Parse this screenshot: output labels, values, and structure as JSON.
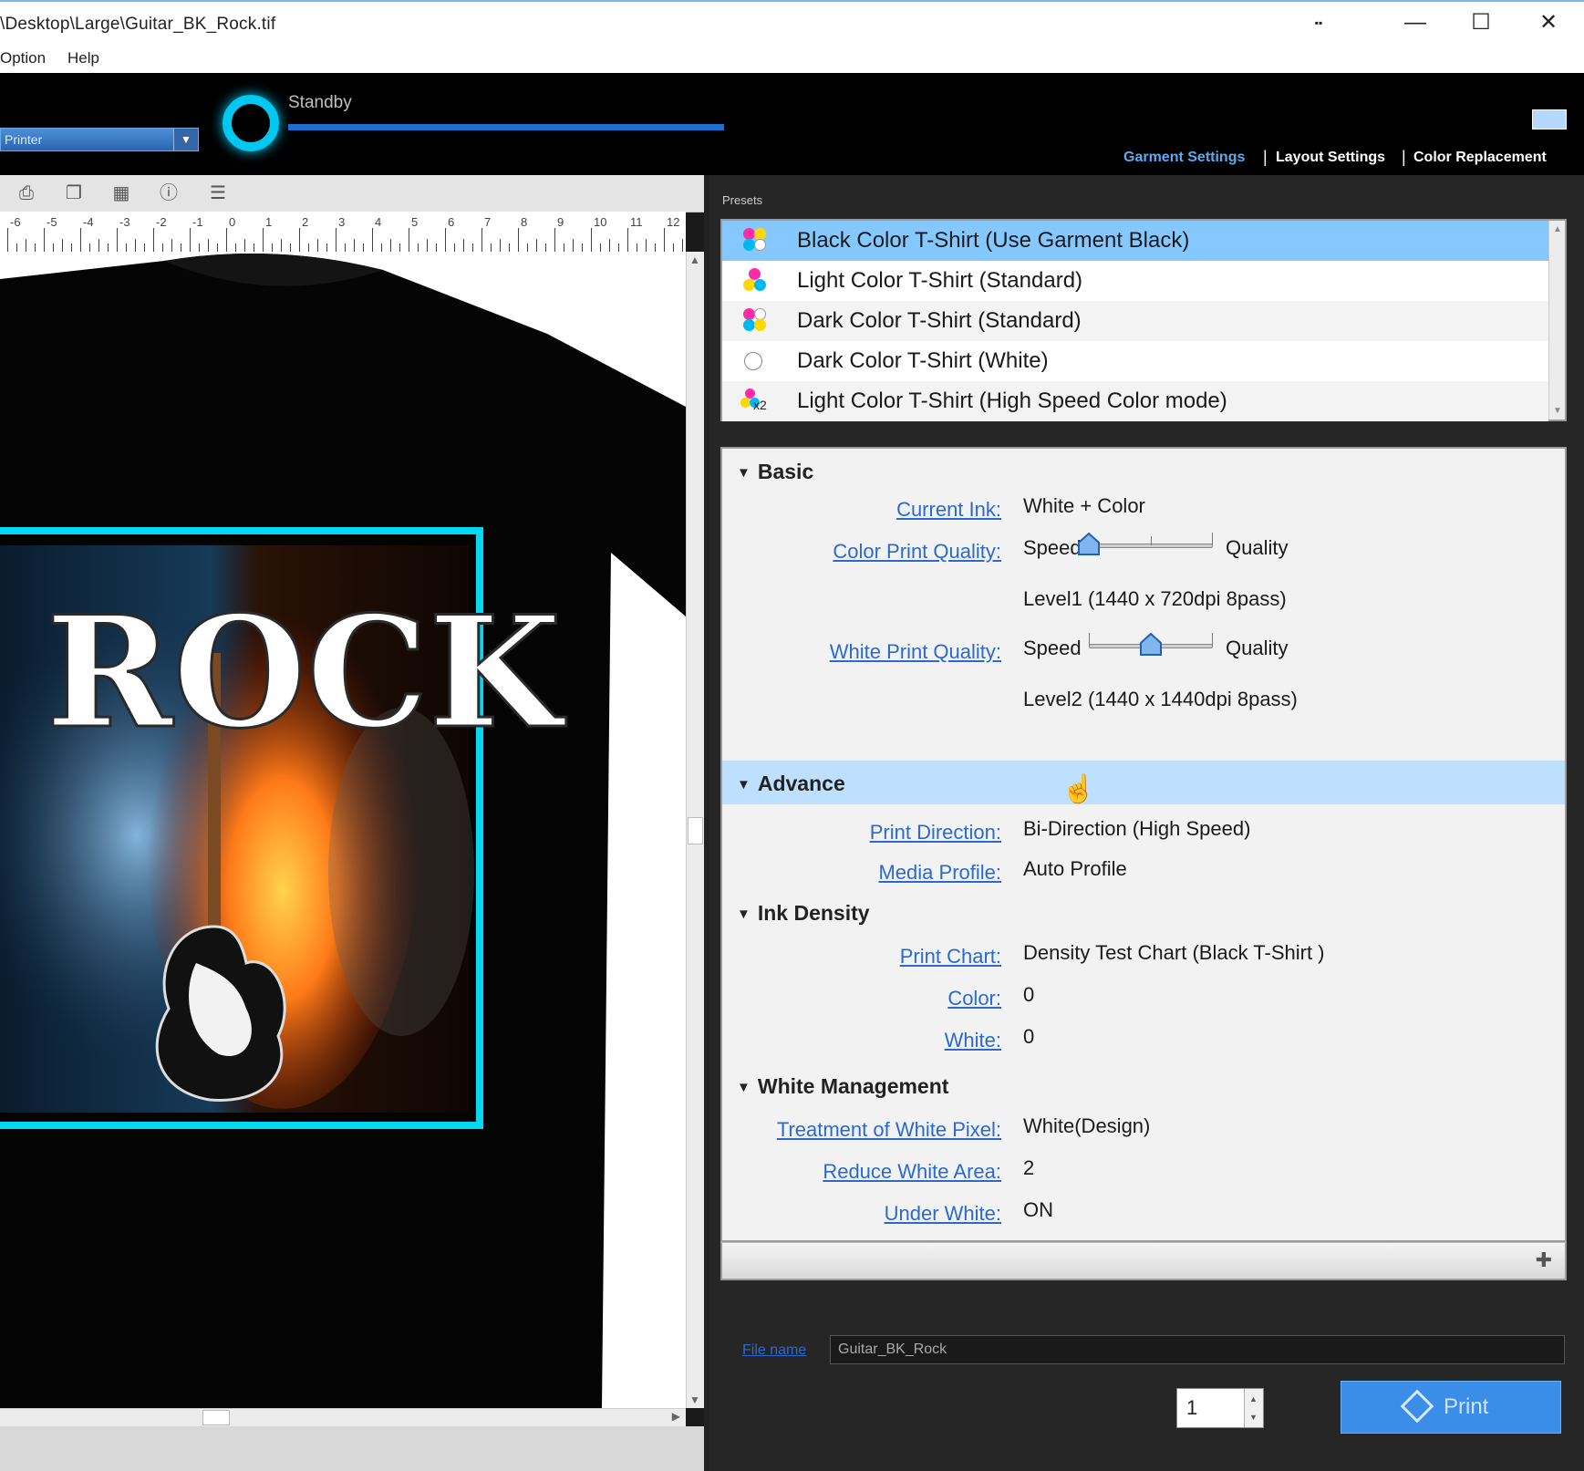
{
  "window": {
    "title": "\\Desktop\\Large\\Guitar_BK_Rock.tif",
    "controls": {
      "restore_glyph": "▪▪",
      "minimize_glyph": "—",
      "maximize_glyph": "☐",
      "close_glyph": "✕"
    }
  },
  "menubar": {
    "items": [
      "Option",
      "Help"
    ]
  },
  "header": {
    "printer_select": "Printer",
    "status_text": "Standby",
    "status_progress": 1.0,
    "nav": [
      "Garment Settings",
      "Layout Settings",
      "Color Replacement"
    ],
    "nav_active": "Garment Settings",
    "nav_separator": "|"
  },
  "canvas": {
    "ruler_labels": [
      "-6",
      "-5",
      "-4",
      "-3",
      "-2",
      "-1",
      "0",
      "1",
      "2",
      "3",
      "4",
      "5",
      "6",
      "7",
      "8",
      "9",
      "10",
      "11",
      "12"
    ],
    "design_text": "ROCK"
  },
  "presets": {
    "label": "Presets",
    "items": [
      {
        "name": "Black Color T-Shirt (Use Garment Black)",
        "icon": "cmyk-dots-icon",
        "selected": true
      },
      {
        "name": "Light Color T-Shirt (Standard)",
        "icon": "cmy-dots-icon",
        "selected": false
      },
      {
        "name": "Dark Color T-Shirt (Standard)",
        "icon": "cmyk-white-dots-icon",
        "selected": false
      },
      {
        "name": "Dark Color T-Shirt (White)",
        "icon": "white-circle-icon",
        "selected": false
      },
      {
        "name": "Light Color T-Shirt (High Speed Color mode)",
        "icon": "cmy-x2-dots-icon",
        "badge": "x2",
        "selected": false
      }
    ]
  },
  "settings": {
    "basic": {
      "title": "Basic",
      "current_ink_label": "Current Ink:",
      "current_ink": "White + Color",
      "color_quality_label": "Color Print Quality:",
      "speed_label": "Speed",
      "quality_label": "Quality",
      "color_quality_level": 0.0,
      "color_quality_text": "Level1 (1440 x 720dpi 8pass)",
      "white_quality_label": "White Print Quality:",
      "white_quality_level": 0.5,
      "white_quality_text": "Level2 (1440 x 1440dpi 8pass)"
    },
    "advance": {
      "title": "Advance",
      "print_direction_label": "Print Direction:",
      "print_direction": "Bi-Direction (High Speed)",
      "media_profile_label": "Media Profile:",
      "media_profile": "Auto Profile"
    },
    "ink_density": {
      "title": "Ink Density",
      "print_chart_label": "Print Chart:",
      "print_chart": "Density Test Chart (Black T-Shirt )",
      "color_label": "Color:",
      "color": "0",
      "white_label": "White:",
      "white": "0"
    },
    "white_management": {
      "title": "White Management",
      "treatment_label": "Treatment of White Pixel:",
      "treatment": "White(Design)",
      "reduce_label": "Reduce White Area:",
      "reduce": "2",
      "under_white_label": "Under White:",
      "under_white": "ON"
    }
  },
  "footer": {
    "filename_label": "File name",
    "filename": "Guitar_BK_Rock",
    "copies": "1",
    "print_button": "Print"
  },
  "colors": {
    "accent": "#3b8ee8",
    "status_ring": "#00c8f0",
    "selection": "#84c8ff",
    "link": "#2a6ad0",
    "frame": "#00e5ff"
  }
}
